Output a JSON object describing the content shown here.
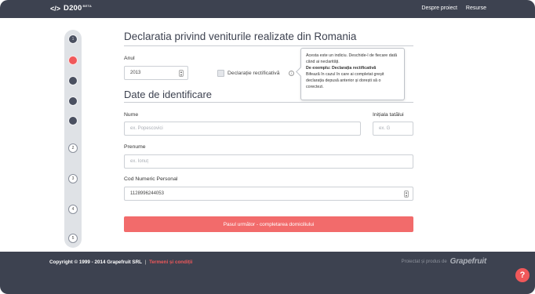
{
  "header": {
    "logo_code": "</>",
    "logo_name": "D200",
    "logo_badge": "BETA",
    "nav": [
      "Despre proiect",
      "Resurse"
    ]
  },
  "steps": {
    "labels": [
      "1",
      "",
      "",
      "",
      "",
      "2",
      "3",
      "4",
      "5"
    ],
    "active_index": 1
  },
  "form": {
    "title": "Declaratia privind veniturile realizate din Romania",
    "year_label": "Anul",
    "year_value": "2013",
    "rectificativa_label": "Declarație rectificativă",
    "section_title": "Date de identificare",
    "nume_label": "Nume",
    "nume_placeholder": "ex. Popescovici",
    "initiala_label": "Inițiala tatălui",
    "initiala_placeholder": "ex. G",
    "prenume_label": "Prenume",
    "prenume_placeholder": "ex. Ionuț",
    "cnp_label": "Cod Numeric Personal",
    "cnp_value": "1128996244053",
    "next_button": "Pasul următor - completarea domiciliului"
  },
  "tooltip": {
    "line1": "Acesta este un indiciu. Deschide-l de fiecare dată când ai neclarități.",
    "line2": "De exemplu: Declarația rectificativă",
    "line3": "Bifează în cazul în care ai completat greșit declarația depusă anterior și dorești să o corectezi."
  },
  "footer": {
    "copyright": "Copyright © 1999 - 2014 Grapefruit SRL",
    "separator": "|",
    "terms": "Termeni și condiții",
    "credit": "Proiectat și produs de",
    "credit_logo": "Grapefruit"
  },
  "help": {
    "label": "?"
  },
  "colors": {
    "dark": "#3d4250",
    "accent": "#f0585a",
    "button": "#f26b6b"
  }
}
